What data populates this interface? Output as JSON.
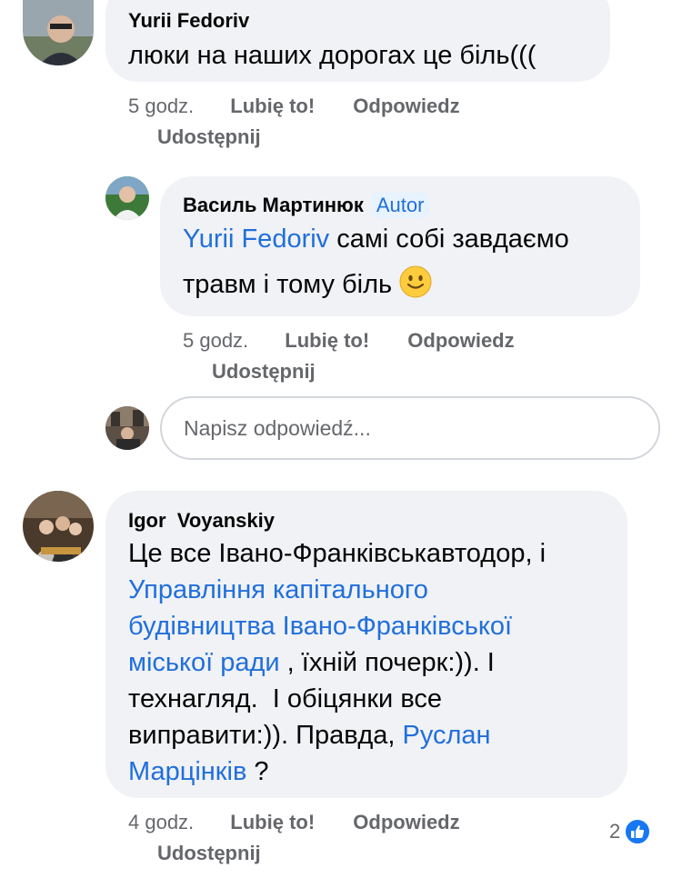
{
  "comments": [
    {
      "author": "Yurii Fedoriv",
      "text": "люки на наших дорогах це біль(((",
      "time": "5 godz.",
      "like_label": "Lubię to!",
      "reply_label": "Odpowiedz",
      "share_label": "Udostępnij"
    },
    {
      "author": "Василь Мартинюк",
      "badge": "Autor",
      "mention": "Yurii Fedoriv",
      "text_line1": " самі собі завдаємо",
      "text_line2": "травм і тому біль ",
      "emoji": "slightly-smiling-face-icon",
      "time": "5 godz.",
      "like_label": "Lubię to!",
      "reply_label": "Odpowiedz",
      "share_label": "Udostępnij"
    },
    {
      "author": "Igor  Voyanskiy",
      "line1": "Це все Івано-Франківськавтодор, і",
      "link1_line1": "Управління капітального",
      "link1_line2": "будівництва Івано-Франківської",
      "link1_line3": "міської ради",
      "line4_after": " , їхній почерк:)). І",
      "line5": "технагляд.  І обіцянки все",
      "line6_before": "виправити:)). Правда, ",
      "link2_line6": "Руслан",
      "link2_line7": "Марцінків",
      "line7_after": " ?",
      "time": "4 godz.",
      "like_label": "Lubię to!",
      "reply_label": "Odpowiedz",
      "share_label": "Udostępnij",
      "reaction_count": "2",
      "reaction_icon": "thumbs-up-icon"
    }
  ],
  "reply_box": {
    "placeholder": "Napisz odpowiedź..."
  },
  "colors": {
    "link": "#216fdb",
    "bubble": "#f0f2f5",
    "meta": "#65676b",
    "like": "#1877f2"
  }
}
